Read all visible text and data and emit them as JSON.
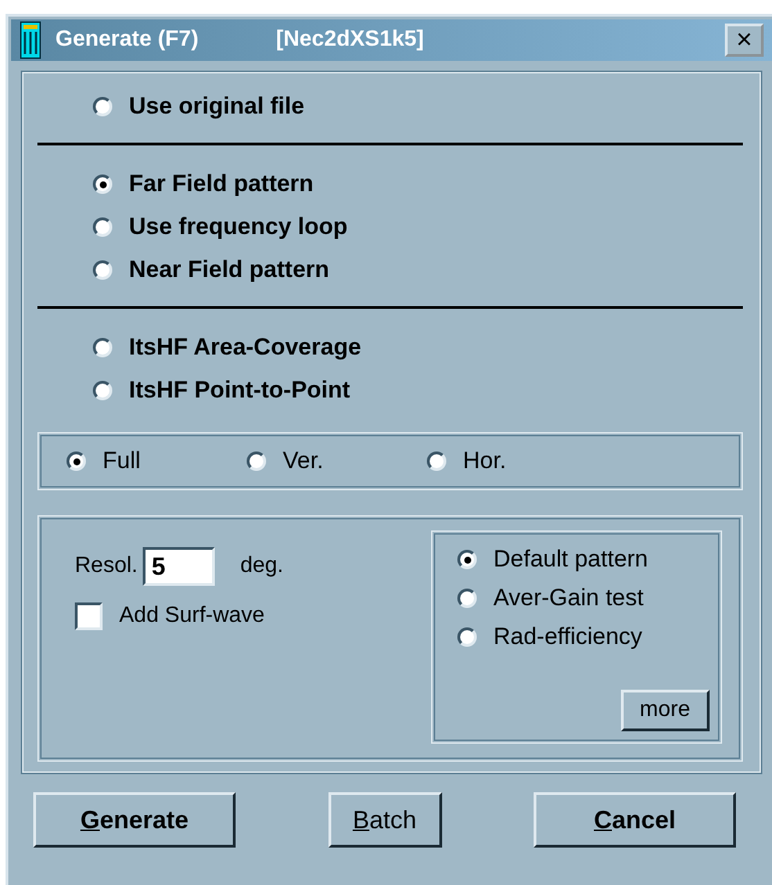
{
  "window": {
    "title": "Generate (F7)",
    "subtitle": "[Nec2dXS1k5]",
    "close": "×"
  },
  "source_options": [
    {
      "label": "Use original file",
      "selected": false
    }
  ],
  "pattern_options": [
    {
      "label": "Far Field pattern",
      "selected": true
    },
    {
      "label": "Use frequency loop",
      "selected": false
    },
    {
      "label": "Near Field pattern",
      "selected": false
    }
  ],
  "coverage_options": [
    {
      "label": "ItsHF Area-Coverage",
      "selected": false
    },
    {
      "label": "ItsHF Point-to-Point",
      "selected": false
    }
  ],
  "plane_options": [
    {
      "label": "Full",
      "selected": true
    },
    {
      "label": "Ver.",
      "selected": false
    },
    {
      "label": "Hor.",
      "selected": false
    }
  ],
  "resolution": {
    "label": "Resol.",
    "value": "5",
    "unit": "deg."
  },
  "surf_wave": {
    "label": "Add Surf-wave",
    "checked": false
  },
  "mode_options": [
    {
      "label": "Default pattern",
      "selected": true
    },
    {
      "label": "Aver-Gain test",
      "selected": false
    },
    {
      "label": "Rad-efficiency",
      "selected": false
    }
  ],
  "more_button": "more",
  "buttons": [
    {
      "accel": "G",
      "rest": "enerate",
      "bold": true
    },
    {
      "accel": "B",
      "rest": "atch",
      "bold": false
    },
    {
      "accel": "C",
      "rest": "ancel",
      "bold": true
    }
  ]
}
